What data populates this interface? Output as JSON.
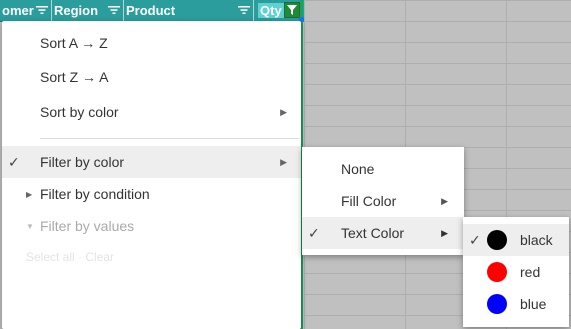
{
  "header": {
    "columns": [
      {
        "label": "omer"
      },
      {
        "label": "Region"
      },
      {
        "label": "Product"
      },
      {
        "label": "Qty"
      }
    ]
  },
  "menu": {
    "items": [
      {
        "label": "Sort A → Z"
      },
      {
        "label": "Sort Z → A"
      },
      {
        "label": "Sort by color"
      },
      {
        "label": "Filter by color"
      },
      {
        "label": "Filter by condition"
      },
      {
        "label": "Filter by values"
      }
    ],
    "faint_text": "Select all · Clear"
  },
  "submenu": {
    "items": [
      {
        "label": "None"
      },
      {
        "label": "Fill Color"
      },
      {
        "label": "Text Color"
      }
    ]
  },
  "colors": {
    "items": [
      {
        "label": "black",
        "color": "#000000"
      },
      {
        "label": "red",
        "color": "#ff0000"
      },
      {
        "label": "blue",
        "color": "#0000ff"
      }
    ]
  }
}
